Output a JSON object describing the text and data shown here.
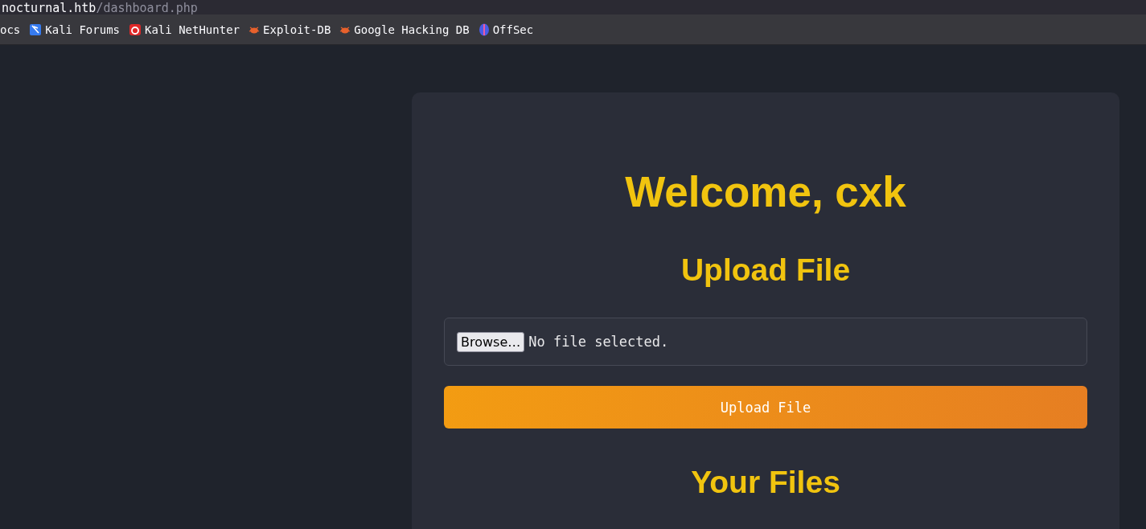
{
  "address_bar": {
    "host": "nocturnal.htb",
    "path": "/dashboard.php"
  },
  "bookmarks": [
    {
      "label": "ocs",
      "kind": "plain"
    },
    {
      "label": "Kali Forums",
      "kind": "kali"
    },
    {
      "label": "Kali NetHunter",
      "kind": "nethunter"
    },
    {
      "label": "Exploit-DB",
      "kind": "bug"
    },
    {
      "label": "Google Hacking DB",
      "kind": "bug"
    },
    {
      "label": "OffSec",
      "kind": "offsec"
    }
  ],
  "card": {
    "title": "Welcome, cxk",
    "upload_heading": "Upload File",
    "file_input": {
      "button": "Browse…",
      "status": "No file selected."
    },
    "upload_button": "Upload File",
    "files_heading": "Your Files"
  }
}
